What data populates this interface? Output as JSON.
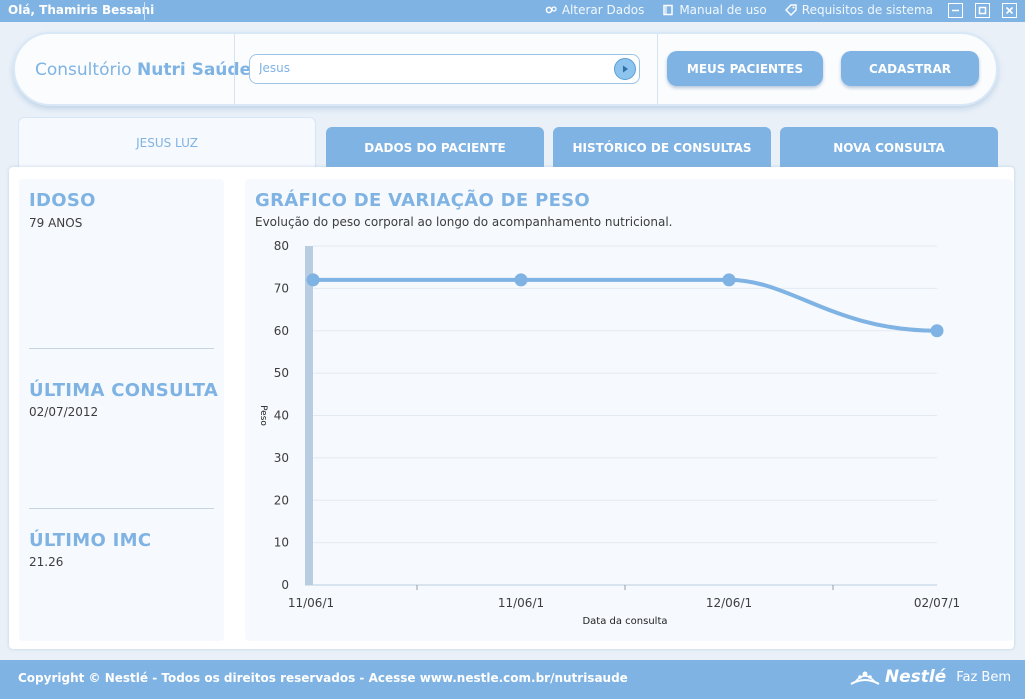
{
  "topbar": {
    "greeting": "Olá, Thamiris Bessani",
    "links": [
      "Alterar Dados",
      "Manual de uso",
      "Requisitos de sistema"
    ]
  },
  "header": {
    "brand_prefix": "Consultório",
    "brand_name": "Nutri Saúde",
    "search_value": "Jesus",
    "btn_patients": "MEUS PACIENTES",
    "btn_register": "CADASTRAR"
  },
  "tabs": {
    "active": "JESUS LUZ",
    "items": [
      "DADOS DO PACIENTE",
      "HISTÓRICO DE CONSULTAS",
      "NOVA CONSULTA"
    ]
  },
  "patient": {
    "category": "IDOSO",
    "age": "79 ANOS",
    "last_consult_title": "ÚLTIMA CONSULTA",
    "last_consult_date": "02/07/2012",
    "last_bmi_title": "ÚLTIMO IMC",
    "last_bmi_value": "21.26"
  },
  "chart_data": {
    "type": "line",
    "title": "GRÁFICO DE VARIAÇÃO DE PESO",
    "subtitle": "Evolução do peso corporal ao longo do acompanhamento nutricional.",
    "xlabel": "Data da consulta",
    "ylabel": "Peso",
    "categories": [
      "11/06/1",
      "11/06/1",
      "12/06/1",
      "02/07/1"
    ],
    "values": [
      72,
      72,
      72,
      60
    ],
    "ylim": [
      0,
      80
    ],
    "yticks": [
      0,
      10,
      20,
      30,
      40,
      50,
      60,
      70,
      80
    ],
    "grid": true,
    "color": "#7fb3e3"
  },
  "footer": {
    "copyright": "Copyright © Nestlé - Todos os direitos reservados - Acesse www.nestle.com.br/nutrisaude",
    "logo_text": "Nestlé",
    "slogan": "Faz Bem"
  },
  "colors": {
    "accent": "#7fb3e3",
    "text": "#3d3d3d",
    "background": "#e9f0f8"
  }
}
